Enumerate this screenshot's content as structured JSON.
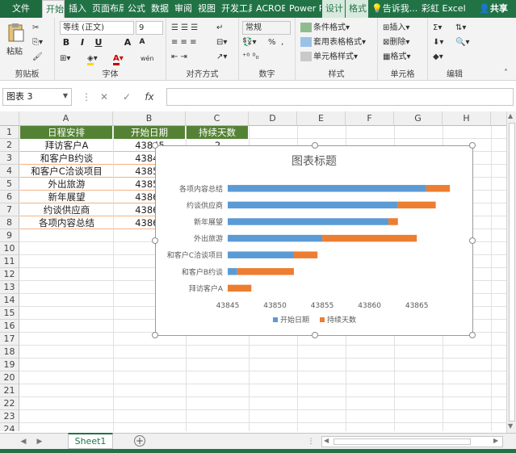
{
  "tabs": {
    "file": "文件",
    "items": [
      "开始",
      "插入",
      "页面布局",
      "公式",
      "数据",
      "审阅",
      "视图",
      "开发工具",
      "ACROBAT",
      "Power P"
    ],
    "context": [
      "设计",
      "格式"
    ],
    "tell_me": "告诉我...",
    "user": "彩虹 Excel",
    "share": "共享"
  },
  "ribbon": {
    "clipboard": {
      "label": "剪贴板",
      "paste": "粘贴"
    },
    "font": {
      "label": "字体",
      "name": "等线 (正文)",
      "size": "9",
      "bold": "B",
      "italic": "I",
      "underline": "U",
      "grow": "A",
      "shrink": "A",
      "font_color": "A",
      "phonetic": "wén"
    },
    "alignment": {
      "label": "对齐方式"
    },
    "number": {
      "label": "数字",
      "format": "常规",
      "percent": "%",
      "comma": ","
    },
    "styles": {
      "label": "样式",
      "conditional": "条件格式",
      "table": "套用表格格式",
      "cell_styles": "单元格样式"
    },
    "cells": {
      "label": "单元格",
      "insert": "插入",
      "delete": "删除",
      "format": "格式"
    },
    "editing": {
      "label": "编辑"
    }
  },
  "formula_bar": {
    "name_box": "图表 3",
    "fx": "fx",
    "value": ""
  },
  "columns": [
    "A",
    "B",
    "C",
    "D",
    "E",
    "F",
    "G",
    "H"
  ],
  "rows": [
    "1",
    "2",
    "3",
    "4",
    "5",
    "6",
    "7",
    "8",
    "9",
    "10",
    "11",
    "12",
    "13",
    "14",
    "15",
    "16",
    "17",
    "18",
    "19",
    "20",
    "21",
    "22",
    "23",
    "24"
  ],
  "table": {
    "headers": [
      "日程安排",
      "开始日期",
      "持续天数"
    ],
    "rows": [
      [
        "拜访客户A",
        "43845",
        "2"
      ],
      [
        "和客户B约谈",
        "43846",
        ""
      ],
      [
        "和客户C洽谈项目",
        "43852",
        ""
      ],
      [
        "外出旅游",
        "43854",
        ""
      ],
      [
        "新年展望",
        "43862",
        ""
      ],
      [
        "约谈供应商",
        "43863",
        ""
      ],
      [
        "各项内容总结",
        "43864",
        ""
      ]
    ]
  },
  "sheet_tab": "Sheet1",
  "chart_data": {
    "type": "bar",
    "orientation": "horizontal",
    "stacked": true,
    "title": "图表标题",
    "categories": [
      "各项内容总结",
      "约谈供应商",
      "新年展望",
      "外出旅游",
      "和客户C洽谈项目",
      "和客户B约谈",
      "拜访客户A"
    ],
    "series": [
      {
        "name": "开始日期",
        "color": "#5b9bd5",
        "values": [
          43866,
          43863,
          43862,
          43855,
          43852,
          43846,
          43845
        ]
      },
      {
        "name": "持续天数",
        "color": "#ed7d31",
        "values": [
          2.5,
          4,
          1,
          10,
          2.5,
          6,
          2.5
        ]
      }
    ],
    "xlim": [
      43845,
      43869
    ],
    "x_ticks": [
      "43845",
      "43850",
      "43855",
      "43860",
      "43865"
    ],
    "grid": false,
    "legend_position": "bottom"
  }
}
